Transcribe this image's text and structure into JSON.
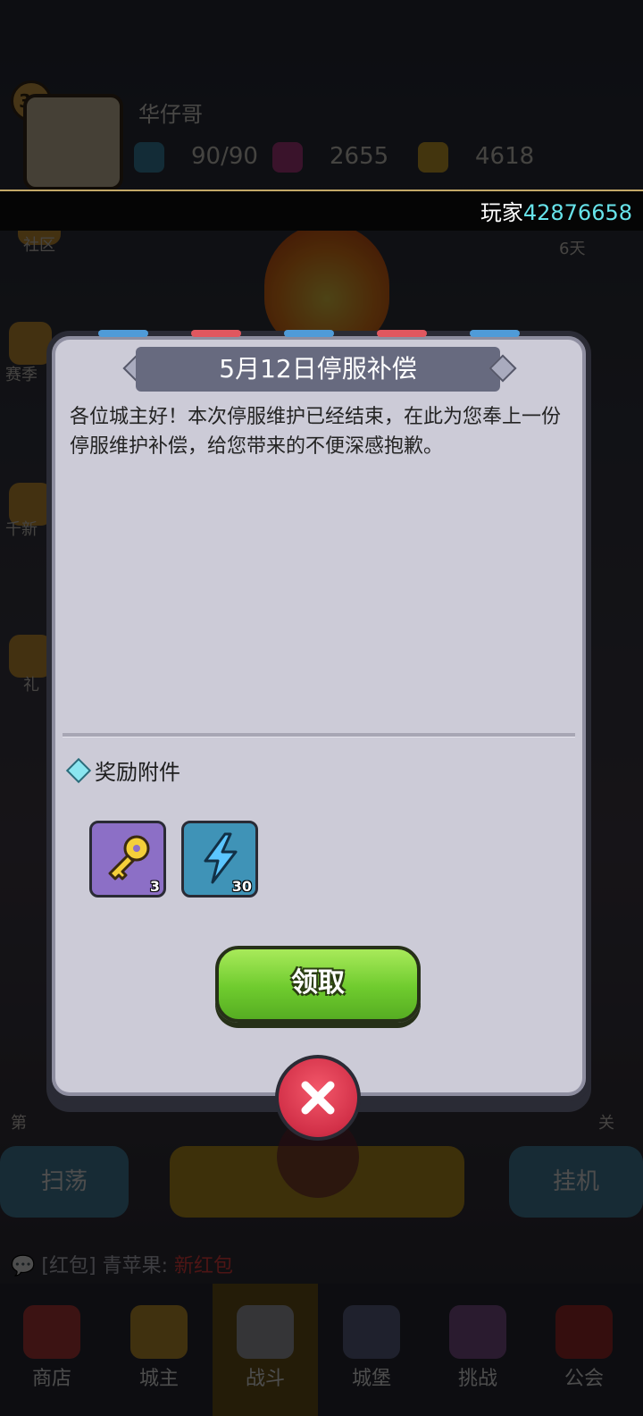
{
  "background": {
    "player": {
      "level": "31",
      "name": "华仔哥",
      "energy": "90/90",
      "gems": "2655",
      "gold": "4618"
    },
    "uid_label": "玩家",
    "uid_number": "42876658",
    "side_labels": {
      "community": "社区",
      "timer": "6天",
      "chapter": "第34章",
      "season": "赛季",
      "left_misc": "千新",
      "gift": "礼"
    },
    "buttons": {
      "sweep": "扫荡",
      "afk": "挂机"
    },
    "chat": {
      "channel": "[红包]",
      "user": "青苹果:",
      "message": "新红包"
    },
    "stage_left": "第",
    "stage_right": "关",
    "nav": [
      "商店",
      "城主",
      "战斗",
      "城堡",
      "挑战",
      "公会"
    ]
  },
  "dialog": {
    "title": "5月12日停服补偿",
    "body": "各位城主好！本次停服维护已经结束，在此为您奉上一份停服维护补偿，给您带来的不便深感抱歉。",
    "attachments_label": "奖励附件",
    "rewards": [
      {
        "item": "key-icon",
        "count": "3"
      },
      {
        "item": "energy-bolt-icon",
        "count": "30"
      }
    ],
    "claim_label": "领取"
  },
  "colors": {
    "dialog_bg": "#cccbd7",
    "ribbon": "#676a7f",
    "claim_green": "#6fcb2e",
    "close_red": "#d23048",
    "uid_cyan": "#67e3ea"
  }
}
